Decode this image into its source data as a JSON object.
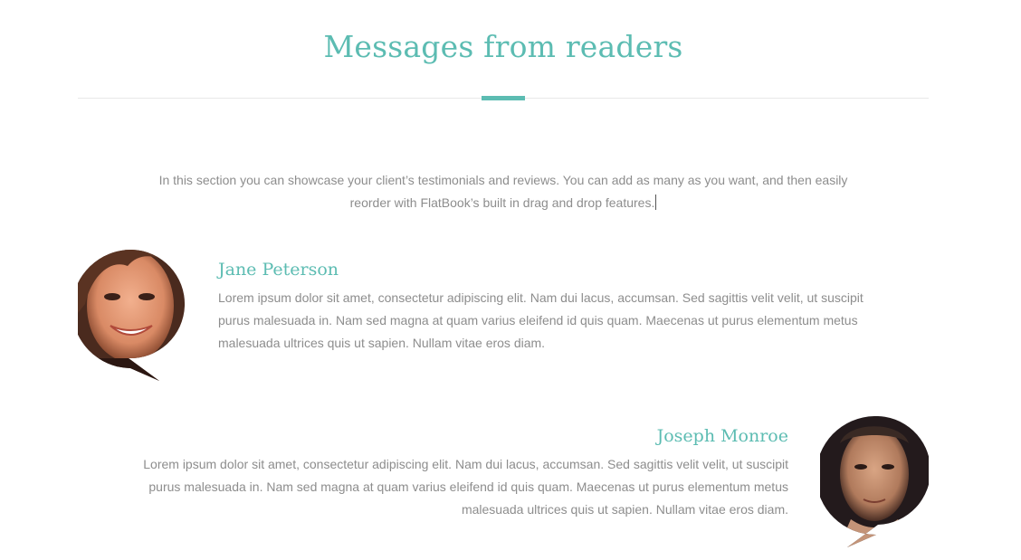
{
  "section": {
    "title": "Messages from readers",
    "accent_color": "#5cbcb2",
    "intro": "In this section you can showcase your client’s testimonials and reviews. You can add as many as you want, and then easily reorder with FlatBook’s built in drag and drop features."
  },
  "testimonials": [
    {
      "name": "Jane Peterson",
      "avatar_icon": "avatar-speech-bubble-left",
      "text": "Lorem ipsum dolor sit amet, consectetur adipiscing elit. Nam dui lacus, accumsan. Sed sagittis velit velit, ut suscipit purus malesuada in. Nam sed magna at quam varius eleifend id quis quam. Maecenas ut purus elementum metus malesuada ultrices quis ut sapien. Nullam vitae eros diam."
    },
    {
      "name": "Joseph Monroe",
      "avatar_icon": "avatar-speech-bubble-right",
      "text": "Lorem ipsum dolor sit amet, consectetur adipiscing elit. Nam dui lacus, accumsan. Sed sagittis velit velit, ut suscipit purus malesuada in. Nam sed magna at quam varius eleifend id quis quam. Maecenas ut purus elementum metus malesuada ultrices quis ut sapien. Nullam vitae eros diam."
    }
  ]
}
